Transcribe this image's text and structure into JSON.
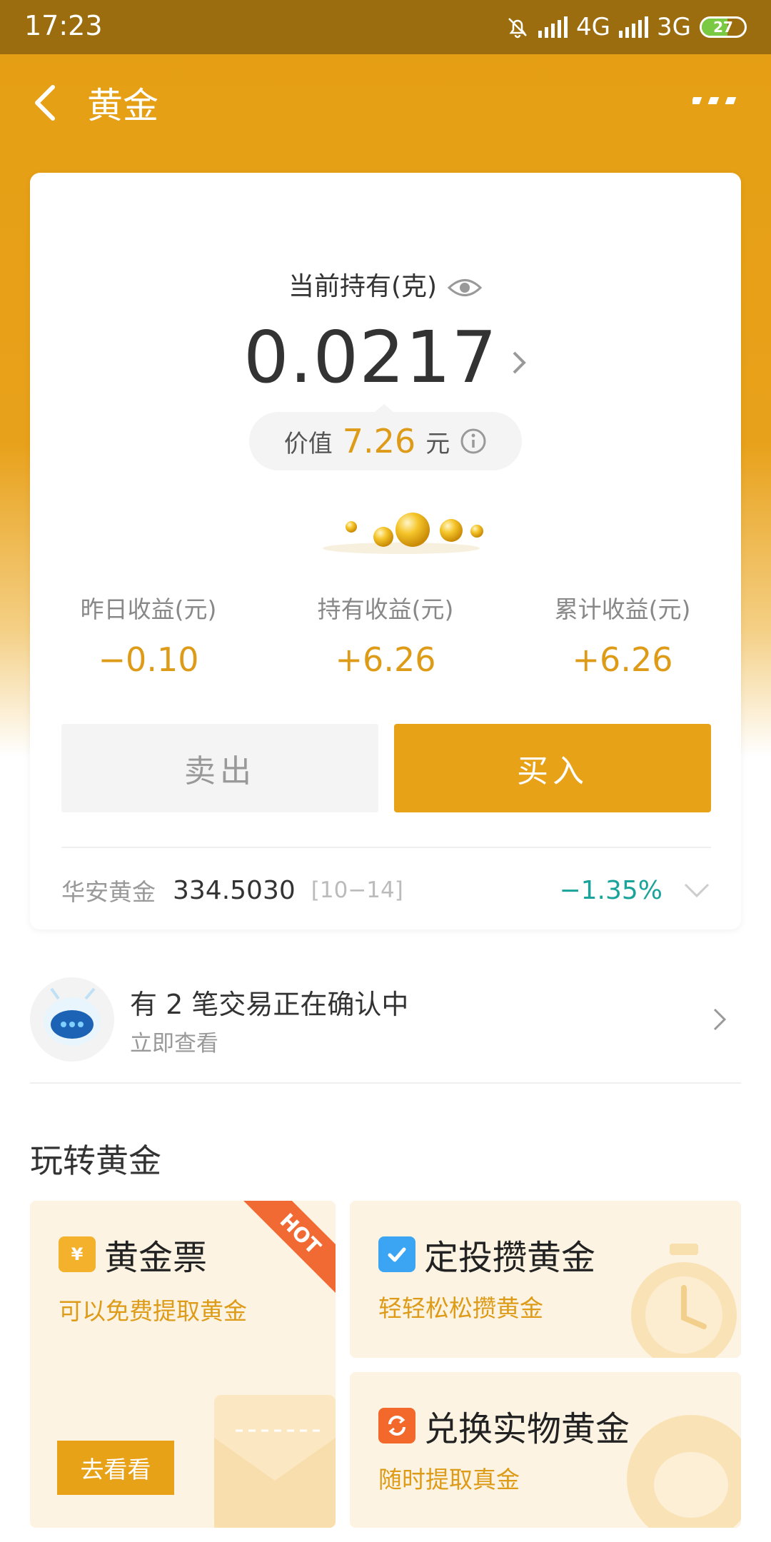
{
  "status_bar": {
    "time": "17:23",
    "network_1": "4G",
    "network_2": "3G",
    "battery": "27"
  },
  "nav": {
    "title": "黄金"
  },
  "holding": {
    "label": "当前持有(克)",
    "grams": "0.0217",
    "value_label": "价值",
    "value_amount": "7.26",
    "value_unit": "元"
  },
  "stats": [
    {
      "label": "昨日收益(元)",
      "value": "−0.10"
    },
    {
      "label": "持有收益(元)",
      "value": "+6.26"
    },
    {
      "label": "累计收益(元)",
      "value": "+6.26"
    }
  ],
  "actions": {
    "sell_label": "卖出",
    "buy_label": "买入"
  },
  "ticker": {
    "name": "华安黄金",
    "price": "334.5030",
    "date": "[10−14]",
    "change": "−1.35%"
  },
  "notice": {
    "title": "有 2 笔交易正在确认中",
    "subtitle": "立即查看"
  },
  "section": {
    "title": "玩转黄金"
  },
  "tiles": [
    {
      "title": "黄金票",
      "subtitle": "可以免费提取黄金",
      "badge": "HOT",
      "button": "去看看",
      "icon": "yuan-ticket-icon"
    },
    {
      "title": "定投攒黄金",
      "subtitle": "轻轻松松攒黄金",
      "icon": "calendar-check-icon"
    },
    {
      "title": "兑换实物黄金",
      "subtitle": "随时提取真金",
      "icon": "exchange-icon"
    }
  ],
  "colors": {
    "brand_gold": "#e8a217",
    "gold_text": "#dd9b18",
    "down_teal": "#1aa39a",
    "hot_orange": "#f26a33"
  }
}
